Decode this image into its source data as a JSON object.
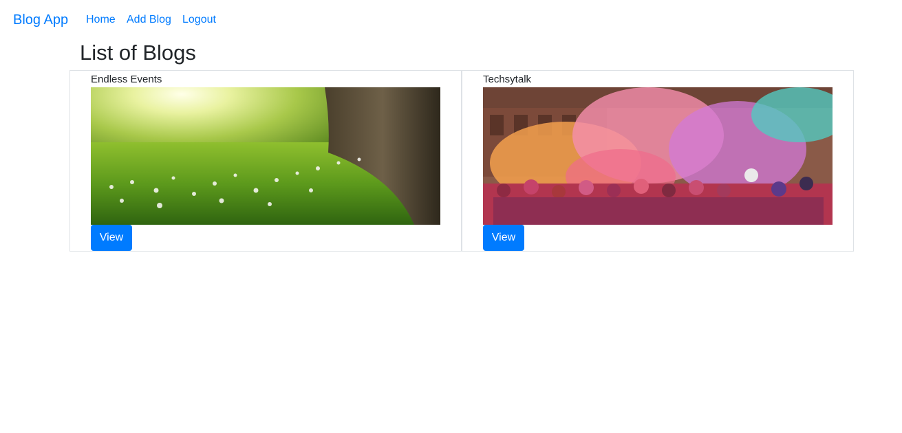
{
  "nav": {
    "brand": "Blog App",
    "links": [
      {
        "label": "Home"
      },
      {
        "label": "Add Blog"
      },
      {
        "label": "Logout"
      }
    ]
  },
  "page": {
    "title": "List of Blogs"
  },
  "blogs": [
    {
      "title": "Endless Events",
      "image": "meadow-tree-photo",
      "button_label": "View"
    },
    {
      "title": "Techsytalk",
      "image": "holi-festival-crowd-photo",
      "button_label": "View"
    }
  ],
  "colors": {
    "primary": "#007bff",
    "border": "#dee2e6",
    "text": "#212529"
  }
}
